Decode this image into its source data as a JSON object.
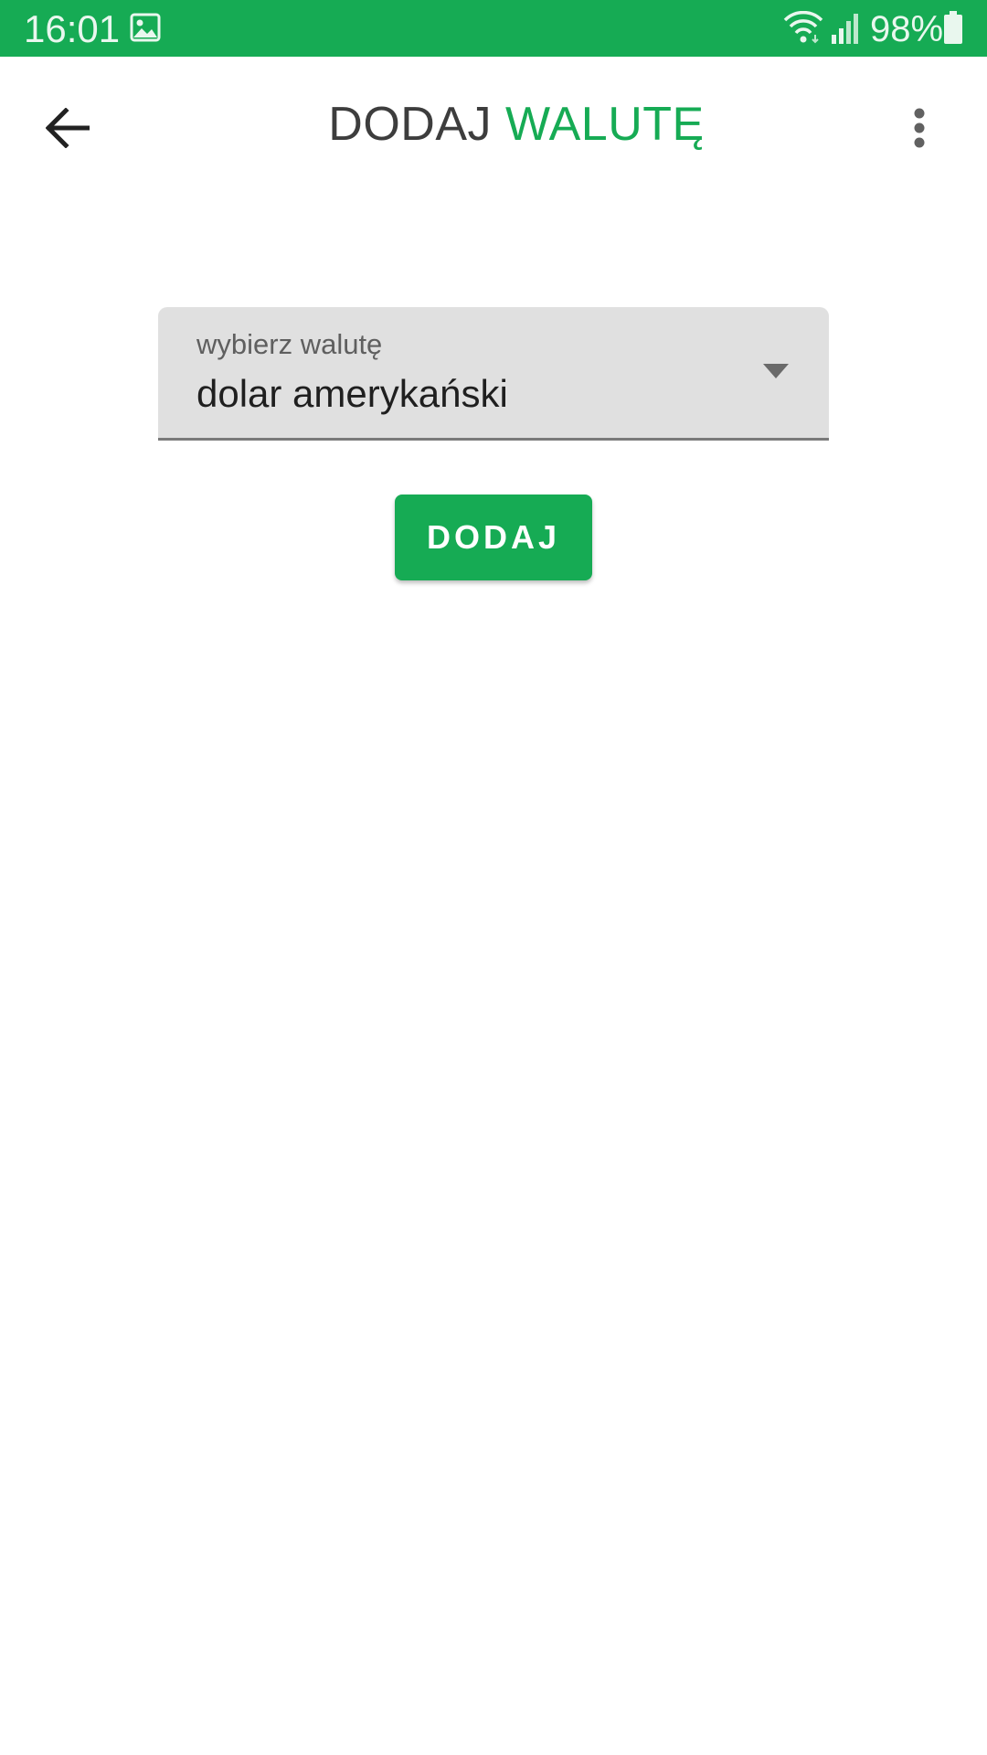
{
  "status_bar": {
    "time": "16:01",
    "battery_percent": "98%",
    "background_color": "#16ab54",
    "icons": [
      "gallery-icon",
      "wifi-icon",
      "signal-icon",
      "battery-icon"
    ]
  },
  "app_bar": {
    "title_part_1": "DODAJ",
    "title_part_2": "WALUTĘ",
    "title_colors": [
      "#3d3d3d",
      "#16ab54"
    ],
    "icons": [
      "arrow-back-icon",
      "more-vert-icon"
    ]
  },
  "currency_select": {
    "label": "wybierz walutę",
    "selected_value": "dolar amerykański",
    "icon": "dropdown-arrow-icon"
  },
  "add_button": {
    "label": "DODAJ",
    "color": "#16ab54"
  }
}
